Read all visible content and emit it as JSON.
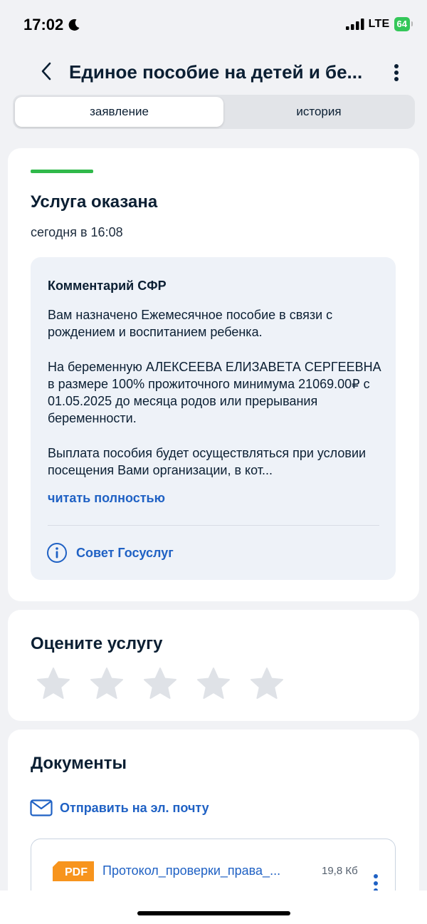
{
  "status_bar": {
    "time": "17:02",
    "network": "LTE",
    "battery": "64",
    "icons": [
      "moon-icon",
      "signal-icon",
      "battery-icon"
    ]
  },
  "header": {
    "title": "Единое пособие на детей и бе...",
    "icons": [
      "chevron-left-icon",
      "more-vertical-icon"
    ]
  },
  "tabs": [
    {
      "label": "заявление",
      "active": true
    },
    {
      "label": "история",
      "active": false
    }
  ],
  "status_card": {
    "status_color": "#30b94a",
    "title": "Услуга оказана",
    "date": "сегодня в 16:08",
    "comment": {
      "heading": "Комментарий СФР",
      "paragraph1": "Вам назначено Ежемесячное пособие в связи с рождением и воспитанием ребенка.",
      "paragraph2": "На беременную АЛЕКСЕЕВА ЕЛИЗАВЕТА СЕРГЕЕВНА в размере 100% прожиточного минимума 21069.00₽ с 01.05.2025 до месяца родов или прерывания беременности.",
      "paragraph3": "Выплата пособия будет осуществляться при условии посещения Вами организации, в кот...",
      "read_more": "читать полностью",
      "advice": "Совет Госуслуг",
      "advice_icon": "info-icon"
    }
  },
  "rating": {
    "title": "Оцените услугу",
    "stars_total": 5,
    "stars_selected": 0,
    "star_color": "#dfe2e7"
  },
  "documents": {
    "title": "Документы",
    "send_email": "Отправить на эл. почту",
    "send_icon": "mail-icon",
    "items": [
      {
        "badge": "PDF",
        "badge_color": "#f7941d",
        "name": "Протокол_проверки_права_...",
        "size": "19,8 Кб"
      }
    ]
  },
  "colors": {
    "accent": "#1f61c4",
    "text": "#0b1f33",
    "background": "#f1f2f5",
    "success": "#30b94a"
  }
}
